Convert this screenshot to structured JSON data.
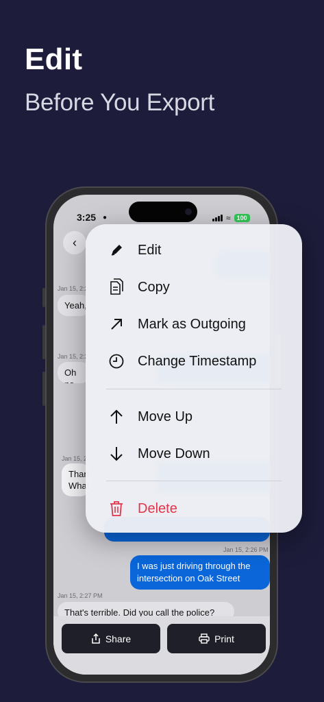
{
  "hero": {
    "title": "Edit",
    "subtitle": "Before You Export"
  },
  "status": {
    "time": "3:25",
    "battery": "100"
  },
  "chat": {
    "messages": [
      {
        "time": "Jan 15, 2:2",
        "text": "Yeah,"
      },
      {
        "time": "Jan 15, 2:2",
        "text": "Oh no"
      },
      {
        "time": "Jan 15, 2:",
        "text": "Than What"
      },
      {
        "time": "Jan 15, 2:26 PM",
        "text": "I was just driving through the intersection on Oak Street"
      },
      {
        "time": "Jan 15, 2:27 PM",
        "text": "That's terrible. Did you call the police?"
      }
    ]
  },
  "bottom": {
    "share_label": "Share",
    "print_label": "Print"
  },
  "menu": {
    "edit": "Edit",
    "copy": "Copy",
    "mark_outgoing": "Mark as Outgoing",
    "change_timestamp": "Change Timestamp",
    "move_up": "Move Up",
    "move_down": "Move Down",
    "delete": "Delete"
  },
  "colors": {
    "background": "#1d1c3a",
    "outgoing_bubble": "#0a66d9",
    "destructive": "#e0344a",
    "battery": "#34c759"
  },
  "icons": [
    "back-chevron-icon",
    "pencil-icon",
    "copy-icon",
    "arrow-up-right-icon",
    "clock-icon",
    "arrow-up-icon",
    "arrow-down-icon",
    "trash-icon",
    "share-icon",
    "printer-icon"
  ]
}
